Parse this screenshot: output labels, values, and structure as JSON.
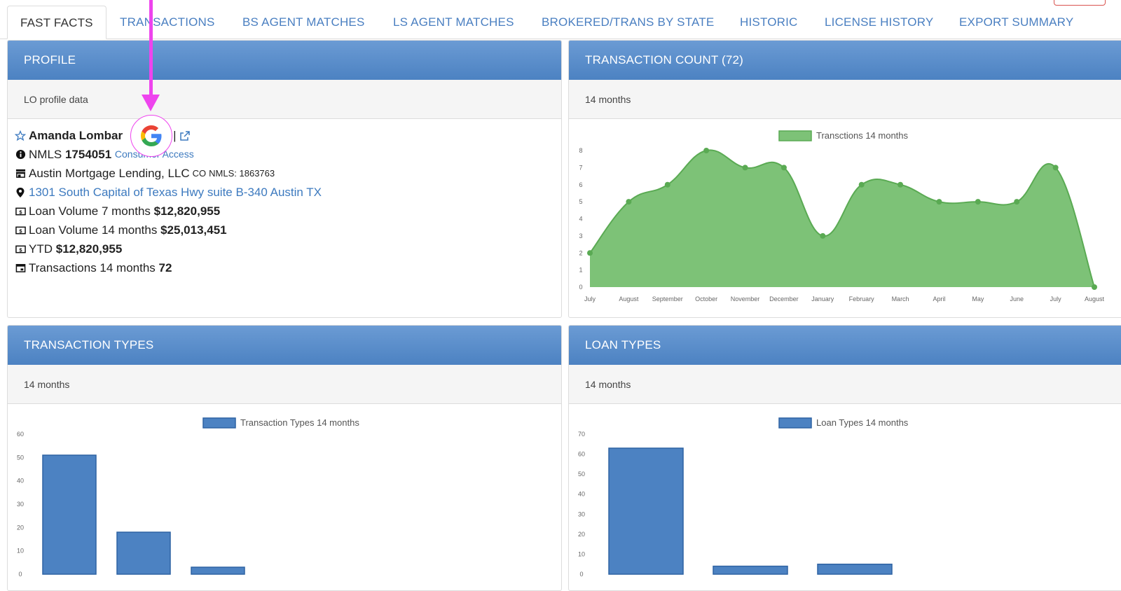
{
  "tabs": [
    {
      "label": "FAST FACTS",
      "active": true
    },
    {
      "label": "TRANSACTIONS"
    },
    {
      "label": "BS AGENT MATCHES"
    },
    {
      "label": "LS AGENT MATCHES"
    },
    {
      "label": "BROKERED/TRANS BY STATE"
    },
    {
      "label": "HISTORIC"
    },
    {
      "label": "LICENSE HISTORY"
    },
    {
      "label": "EXPORT SUMMARY"
    }
  ],
  "profile": {
    "title": "PROFILE",
    "subtitle": "LO profile data",
    "name": "Amanda Lombar",
    "nmls_label": "NMLS",
    "nmls": "1754051",
    "consumer_access": "Consumer Access",
    "company": "Austin Mortgage Lending, LLC",
    "co_label": "CO",
    "co_nmls": "NMLS: 1863763",
    "address": "1301 South Capital of Texas Hwy suite B-340 Austin TX",
    "stats": [
      {
        "label": "Loan Volume 7 months",
        "value": "$12,820,955"
      },
      {
        "label": "Loan Volume 14 months",
        "value": "$25,013,451"
      },
      {
        "label": "YTD",
        "value": "$12,820,955"
      },
      {
        "label": "Transactions 14 months",
        "value": "72"
      }
    ]
  },
  "txn_count": {
    "title": "TRANSACTION COUNT (72)",
    "subtitle": "14 months"
  },
  "txn_types": {
    "title": "TRANSACTION TYPES",
    "subtitle": "14 months"
  },
  "loan_types": {
    "title": "LOAN TYPES",
    "subtitle": "14 months"
  },
  "colors": {
    "accent": "#4c82c2",
    "area_fill": "#7dc277",
    "area_line": "#5aaa53",
    "bar_fill": "#4c82c2",
    "annotation": "#ee44ee"
  },
  "icons": [
    "star-icon",
    "info-icon",
    "store-icon",
    "map-pin-icon",
    "dollar-bill-icon",
    "calendar-icon",
    "copy-icon",
    "external-link-icon",
    "google-icon"
  ],
  "chart_data": [
    {
      "type": "area",
      "legend": "Transctions 14 months",
      "categories": [
        "July",
        "August",
        "September",
        "October",
        "November",
        "December",
        "January",
        "February",
        "March",
        "April",
        "May",
        "June",
        "July",
        "August"
      ],
      "values": [
        2,
        5,
        6,
        8,
        7,
        7,
        3,
        6,
        6,
        5,
        5,
        5,
        7,
        0
      ],
      "ylim": [
        0,
        8
      ],
      "yticks": [
        "0",
        "1",
        "2",
        "3",
        "4",
        "5",
        "6",
        "7",
        "8"
      ]
    },
    {
      "type": "bar",
      "legend": "Transaction Types 14 months",
      "values": [
        51,
        18,
        3
      ],
      "ylim": [
        0,
        60
      ],
      "yticks": [
        "0",
        "10",
        "20",
        "30",
        "40",
        "50",
        "60"
      ]
    },
    {
      "type": "bar",
      "legend": "Loan Types 14 months",
      "values": [
        63,
        4,
        5
      ],
      "ylim": [
        0,
        70
      ],
      "yticks": [
        "0",
        "10",
        "20",
        "30",
        "40",
        "50",
        "60",
        "70"
      ]
    }
  ]
}
